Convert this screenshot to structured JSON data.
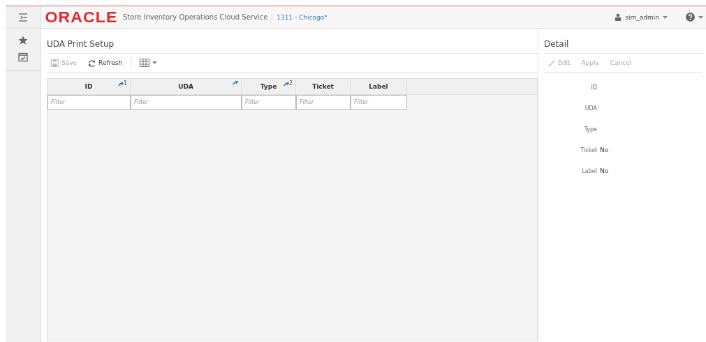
{
  "header": {
    "logo": "ORACLE",
    "product": "Store Inventory Operations Cloud Service",
    "store": "1311 - Chicago*",
    "user": "sim_admin"
  },
  "sidebar": {
    "items": [
      {
        "kind": "favorites"
      },
      {
        "kind": "tasks"
      }
    ]
  },
  "page": {
    "title": "UDA Print Setup",
    "toolbar": [
      {
        "label": "Save",
        "kind": "save",
        "disabled": true
      },
      {
        "label": "Refresh",
        "kind": "refresh",
        "disabled": false
      }
    ],
    "table": {
      "columns": [
        {
          "label": "ID",
          "sorted": true,
          "sort_rank": "1",
          "placeholder": "Filter"
        },
        {
          "label": "UDA",
          "sorted": true,
          "placeholder": "Filter"
        },
        {
          "label": "Type",
          "sorted": true,
          "sort_rank": "2",
          "placeholder": "Filter"
        },
        {
          "label": "Ticket",
          "sorted": false,
          "placeholder": "Filter"
        },
        {
          "label": "Label",
          "sorted": false,
          "placeholder": "Filter"
        }
      ]
    }
  },
  "detail": {
    "title": "Detail",
    "toolbar": [
      {
        "label": "Edit",
        "kind": "edit",
        "disabled": true
      },
      {
        "label": "Apply",
        "kind": "plain",
        "disabled": true
      },
      {
        "label": "Cancel",
        "kind": "plain",
        "disabled": true
      }
    ],
    "fields": [
      {
        "label": "ID"
      },
      {
        "label": "UDA"
      },
      {
        "label": "Type"
      },
      {
        "label": "Ticket",
        "value": "No"
      },
      {
        "label": "Label",
        "value": "No"
      }
    ]
  }
}
